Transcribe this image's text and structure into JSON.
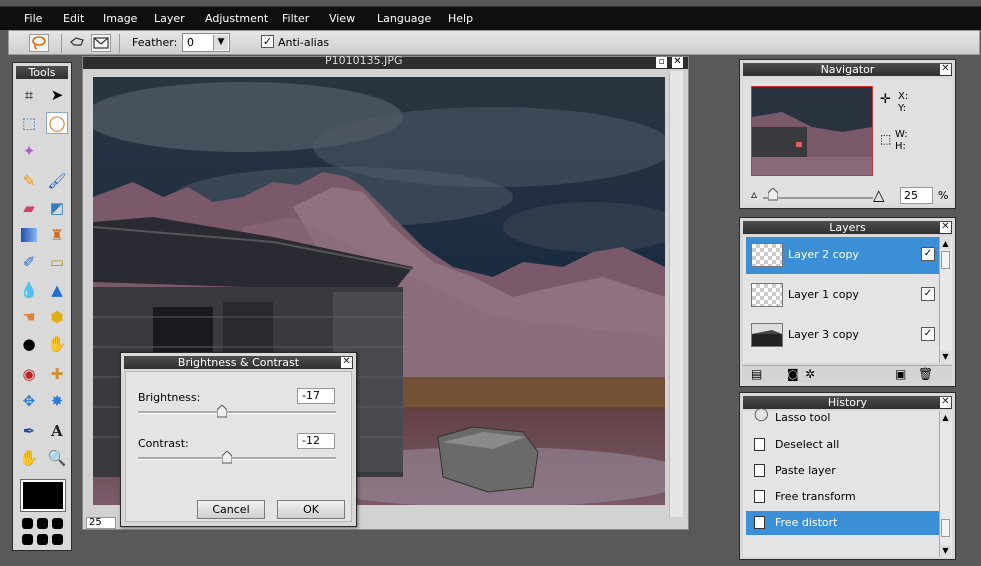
{
  "menu": [
    "File",
    "Edit",
    "Image",
    "Layer",
    "Adjustment",
    "Filter",
    "View",
    "Language",
    "Help"
  ],
  "options": {
    "feather_label": "Feather:",
    "feather_value": "0",
    "antialias_label": "Anti-alias",
    "antialias_checked": true
  },
  "tools": {
    "title": "Tools",
    "foreground_color": "#000000"
  },
  "canvas": {
    "filename": "P1010135.JPG",
    "zoom": "25"
  },
  "dialog": {
    "title": "Brightness & Contrast",
    "brightness_label": "Brightness:",
    "brightness_value": "-17",
    "brightness_level": -17,
    "contrast_label": "Contrast:",
    "contrast_value": "-12",
    "contrast_level": -12,
    "cancel_label": "Cancel",
    "ok_label": "OK"
  },
  "navigator": {
    "title": "Navigator",
    "x_label": "X:",
    "y_label": "Y:",
    "w_label": "W:",
    "h_label": "H:",
    "zoom_value": "25",
    "zoom_unit": "%"
  },
  "layers": {
    "title": "Layers",
    "items": [
      {
        "name": "Layer 2 copy",
        "visible": true,
        "selected": true
      },
      {
        "name": "Layer 1 copy",
        "visible": true,
        "selected": false
      },
      {
        "name": "Layer 3 copy",
        "visible": true,
        "selected": false
      }
    ]
  },
  "history": {
    "title": "History",
    "items": [
      "Lasso tool",
      "Deselect all",
      "Paste layer",
      "Free transform",
      "Free distort"
    ],
    "selected": "Free distort"
  },
  "colors": {
    "accent": "#3a8fd6",
    "menubar": "#0f0f0f",
    "panel_title": "#3a3a3a"
  }
}
